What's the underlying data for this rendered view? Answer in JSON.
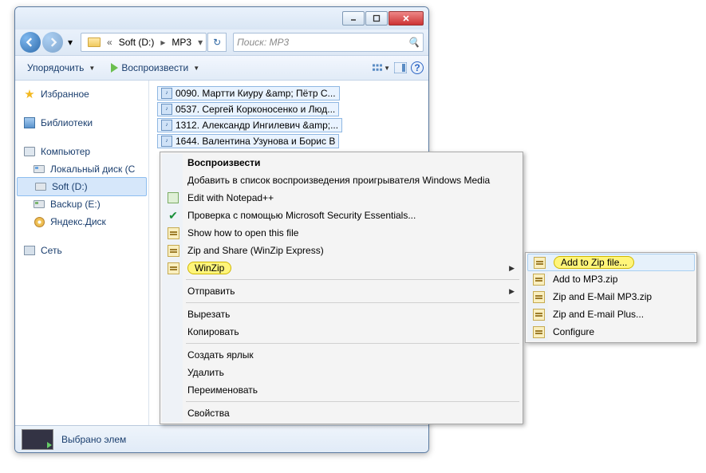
{
  "titlebar": {
    "min": "_",
    "max": "□",
    "close": "×"
  },
  "breadcrumb": {
    "chevrons": "«",
    "seg1": "Soft (D:)",
    "seg2": "MP3"
  },
  "search": {
    "placeholder": "Поиск: MP3"
  },
  "toolbar": {
    "organize": "Упорядочить",
    "play": "Воспроизвести"
  },
  "nav": {
    "favorites": "Избранное",
    "libraries": "Библиотеки",
    "computer": "Компьютер",
    "driveC": "Локальный диск (C",
    "driveD": "Soft (D:)",
    "driveE": "Backup (E:)",
    "yandex": "Яндекс.Диск",
    "network": "Сеть"
  },
  "files": [
    "0090. Мартти Киуру  &amp; Пётр С...",
    "0537. Сергей Корконосенко и Люд...",
    "1312. Александр Ингилевич &amp;...",
    "1644. Валентина Узунова и Борис В"
  ],
  "status": "Выбрано элем",
  "ctx": {
    "play": "Воспроизвести",
    "addPlaylist": "Добавить в список воспроизведения проигрывателя Windows Media",
    "notepad": "Edit with Notepad++",
    "mse": "Проверка с помощью Microsoft Security Essentials...",
    "howopen": "Show how to open this file",
    "zipshare": "Zip and Share (WinZip Express)",
    "winzip": "WinZip",
    "send": "Отправить",
    "cut": "Вырезать",
    "copy": "Копировать",
    "shortcut": "Создать ярлык",
    "delete": "Удалить",
    "rename": "Переименовать",
    "props": "Свойства"
  },
  "sub": {
    "addzip": "Add to Zip file...",
    "addmp3": "Add to MP3.zip",
    "zipmail": "Zip and E-Mail MP3.zip",
    "zipmailplus": "Zip and E-mail Plus...",
    "configure": "Configure"
  }
}
